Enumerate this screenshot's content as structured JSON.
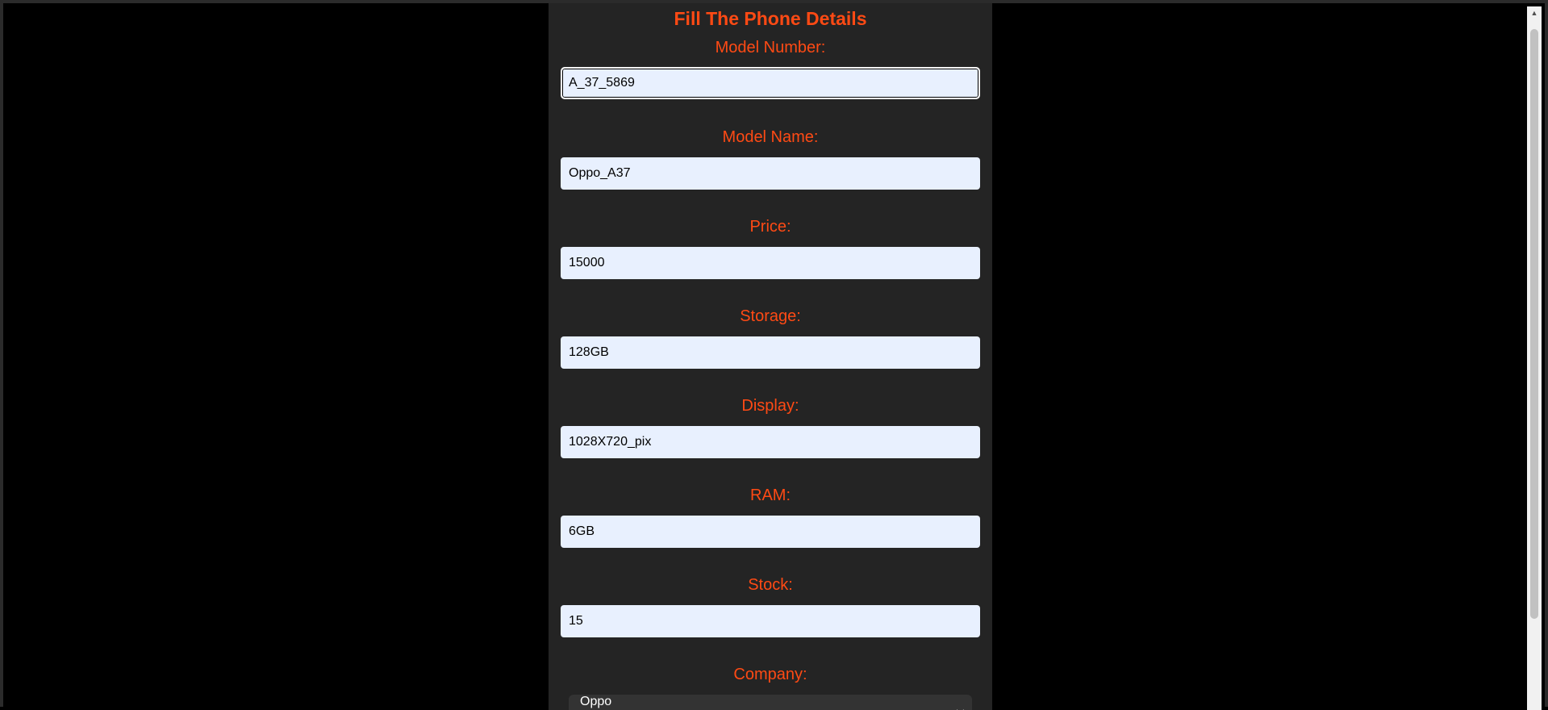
{
  "form": {
    "title": "Fill The Phone Details",
    "fields": [
      {
        "label": "Model Number:",
        "value": "A_37_5869"
      },
      {
        "label": "Model Name:",
        "value": "Oppo_A37"
      },
      {
        "label": "Price:",
        "value": "15000"
      },
      {
        "label": "Storage:",
        "value": "128GB"
      },
      {
        "label": "Display:",
        "value": "1028X720_pix"
      },
      {
        "label": "RAM:",
        "value": "6GB"
      },
      {
        "label": "Stock:",
        "value": "15"
      }
    ],
    "company": {
      "label": "Company:",
      "selected": "Oppo"
    }
  },
  "icons": {
    "select_chevron": "chevron-down-icon",
    "scroll_up": "arrow-up-icon"
  },
  "colors": {
    "accent": "#ff4a14",
    "panel_bg": "#242424",
    "page_bg": "#000000",
    "input_bg": "#e8f0fe"
  }
}
